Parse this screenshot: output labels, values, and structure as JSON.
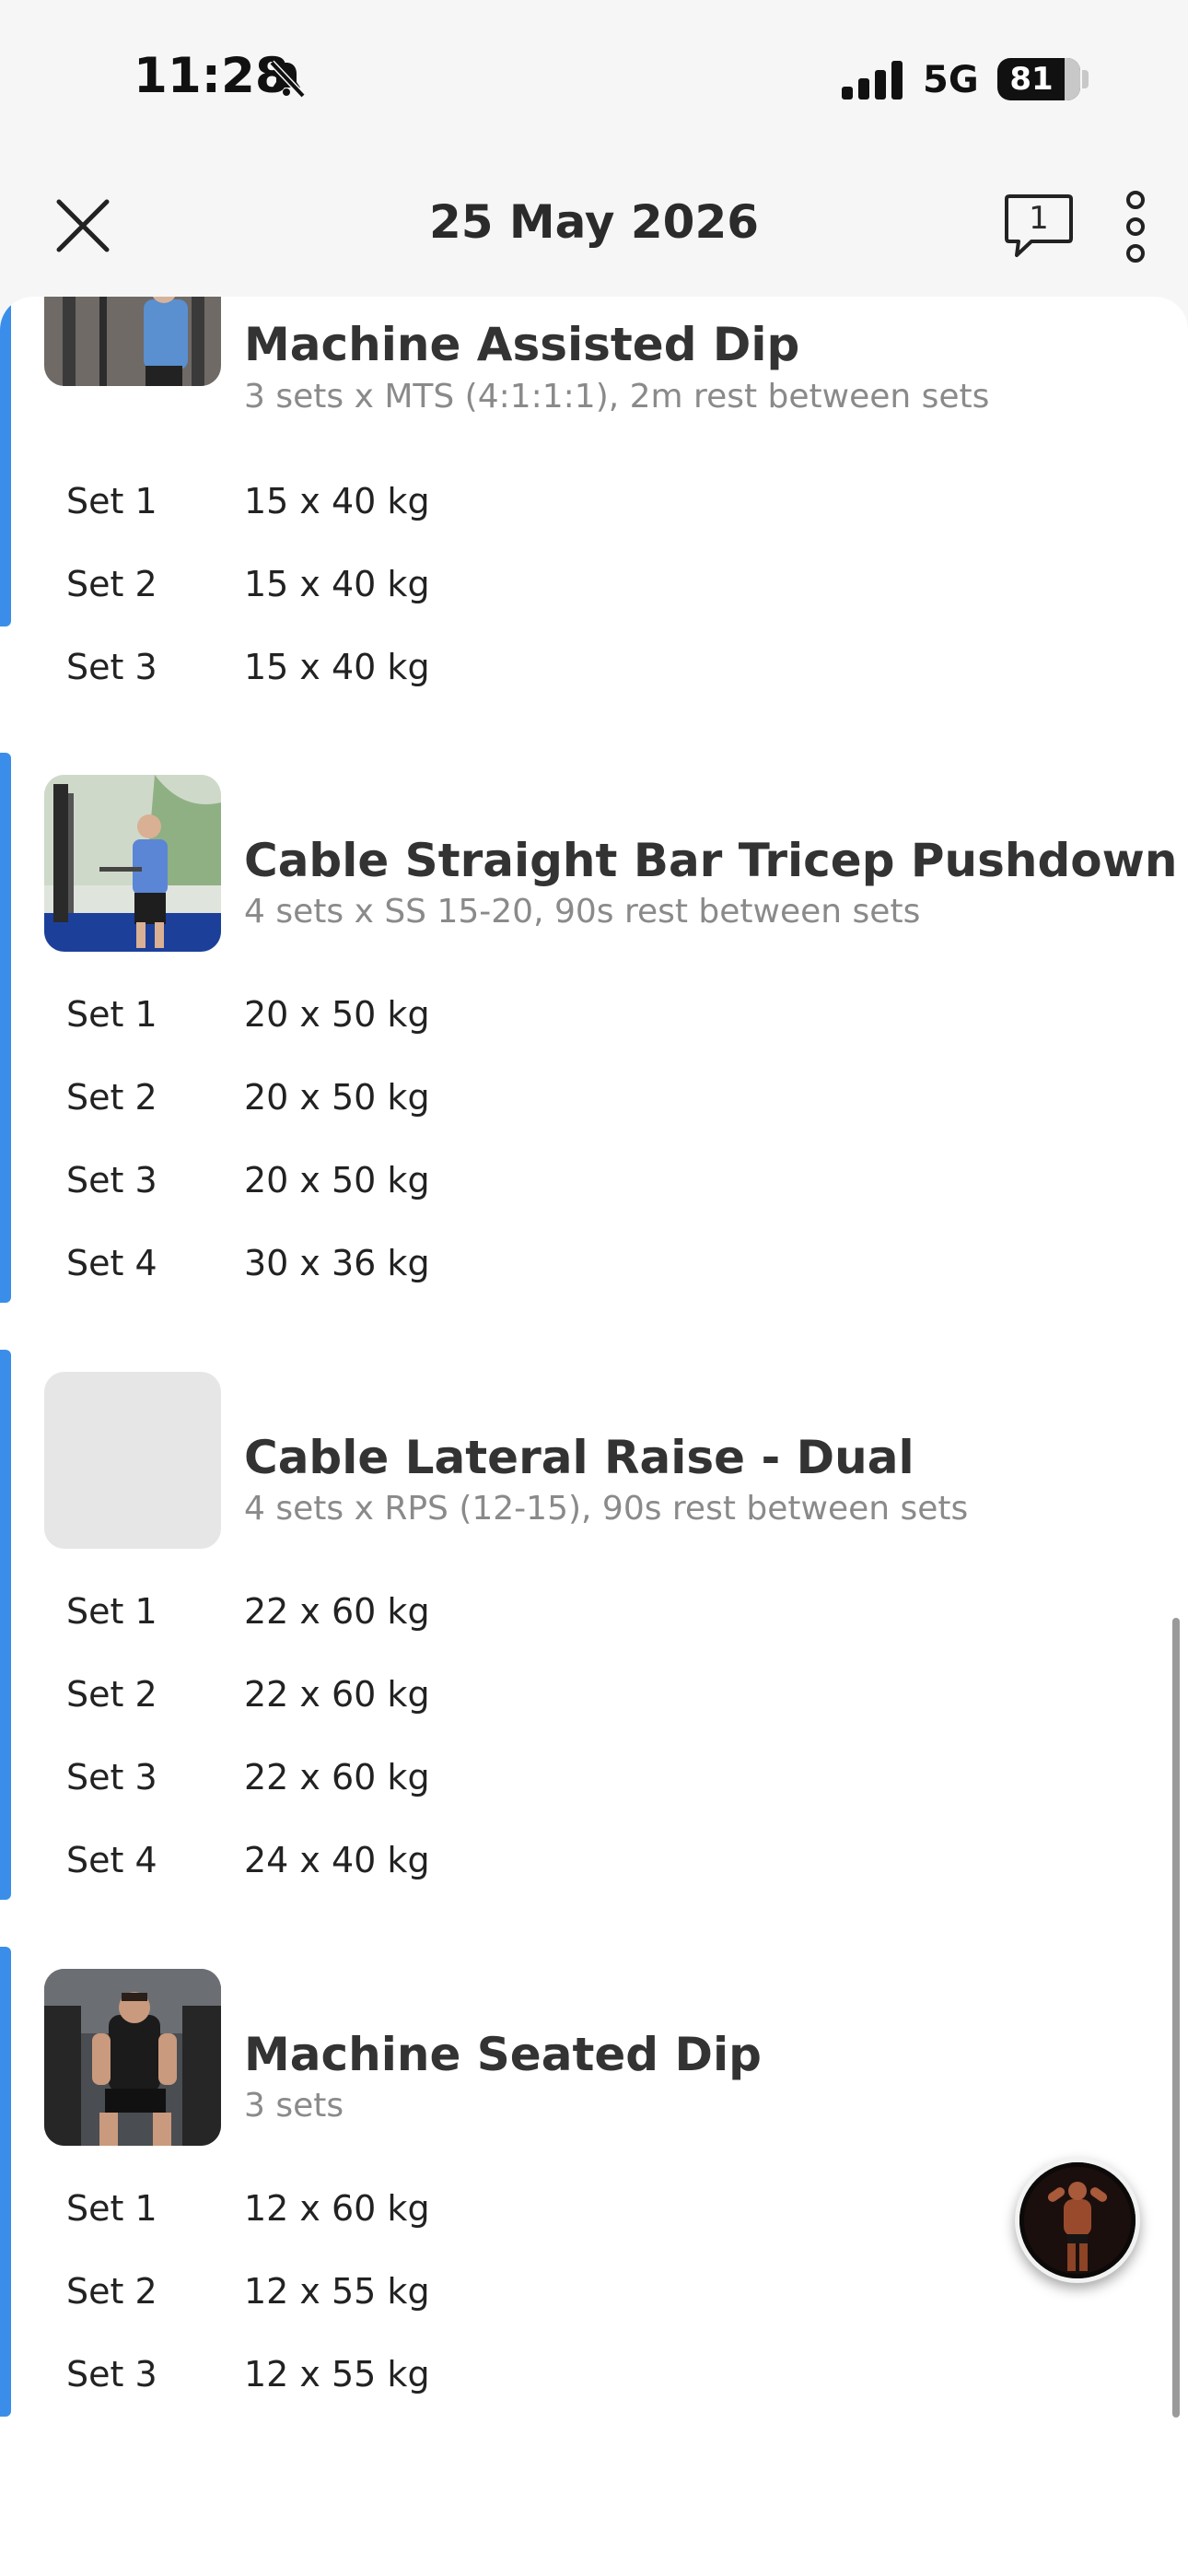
{
  "status_bar": {
    "time": "11:28",
    "network": "5G",
    "battery_percent": "81",
    "battery_level": 0.81
  },
  "header": {
    "title": "25 May 2026",
    "comment_count": "1"
  },
  "colors": {
    "accent": "#3a8eea",
    "background": "#f6f6f6",
    "card": "#ffffff"
  },
  "exercises": [
    {
      "name": "Machine Assisted Dip",
      "description": "3 sets x MTS (4:1:1:1), 2m rest between sets",
      "sets": [
        {
          "label": "Set 1",
          "value": "15 x 40 kg"
        },
        {
          "label": "Set 2",
          "value": "15 x 40 kg"
        },
        {
          "label": "Set 3",
          "value": "15 x 40 kg"
        }
      ]
    },
    {
      "name": "Cable Straight Bar Tricep Pushdown",
      "description": "4 sets x SS 15-20, 90s rest between sets",
      "sets": [
        {
          "label": "Set 1",
          "value": "20 x 50 kg"
        },
        {
          "label": "Set 2",
          "value": "20 x 50 kg"
        },
        {
          "label": "Set 3",
          "value": "20 x 50 kg"
        },
        {
          "label": "Set 4",
          "value": "30 x 36 kg"
        }
      ]
    },
    {
      "name": "Cable Lateral Raise - Dual",
      "description": "4 sets x RPS (12-15), 90s rest between sets",
      "sets": [
        {
          "label": "Set 1",
          "value": "22 x 60 kg"
        },
        {
          "label": "Set 2",
          "value": "22 x 60 kg"
        },
        {
          "label": "Set 3",
          "value": "22 x 60 kg"
        },
        {
          "label": "Set 4",
          "value": "24 x 40 kg"
        }
      ]
    },
    {
      "name": "Machine Seated Dip",
      "description": "3 sets",
      "sets": [
        {
          "label": "Set 1",
          "value": "12 x 60 kg"
        },
        {
          "label": "Set 2",
          "value": "12 x 55 kg"
        },
        {
          "label": "Set 3",
          "value": "12 x 55 kg"
        }
      ]
    }
  ]
}
